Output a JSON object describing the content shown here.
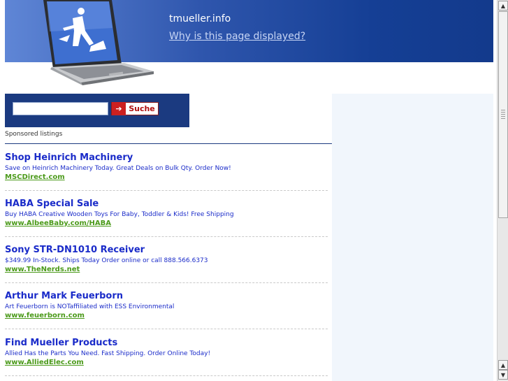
{
  "header": {
    "domain": "tmueller.info",
    "why_link": "Why is this page displayed?"
  },
  "search": {
    "value": "",
    "placeholder": "",
    "button_label": "Suche"
  },
  "sponsored_label": "Sponsored listings",
  "listings": [
    {
      "title": "Shop Heinrich Machinery",
      "desc": "Save on Heinrich Machinery Today. Great Deals on Bulk Qty. Order Now!",
      "url": "MSCDirect.com"
    },
    {
      "title": "HABA Special Sale",
      "desc": "Buy HABA Creative Wooden Toys For Baby, Toddler & Kids! Free Shipping",
      "url": "www.AlbeeBaby.com/HABA"
    },
    {
      "title": "Sony STR-DN1010 Receiver",
      "desc": "$349.99 In-Stock. Ships Today Order online or call 888.566.6373",
      "url": "www.TheNerds.net"
    },
    {
      "title": "Arthur Mark Feuerborn",
      "desc": "Art Feuerborn is NOTaffiliated with ESS Environmental",
      "url": "www.feuerborn.com"
    },
    {
      "title": "Find Mueller Products",
      "desc": "Allied Has the Parts You Need. Fast Shipping. Order Online Today!",
      "url": "www.AlliedElec.com"
    }
  ],
  "icons": {
    "search_arrow": "arrow-right-icon",
    "scroll_up": "chevron-up-icon",
    "scroll_down": "chevron-down-icon",
    "laptop": "laptop-under-construction-icon"
  },
  "colors": {
    "banner_dark": "#133a8c",
    "link_blue": "#1a2bc9",
    "url_green": "#4b9a1a",
    "button_red": "#cc2020"
  }
}
